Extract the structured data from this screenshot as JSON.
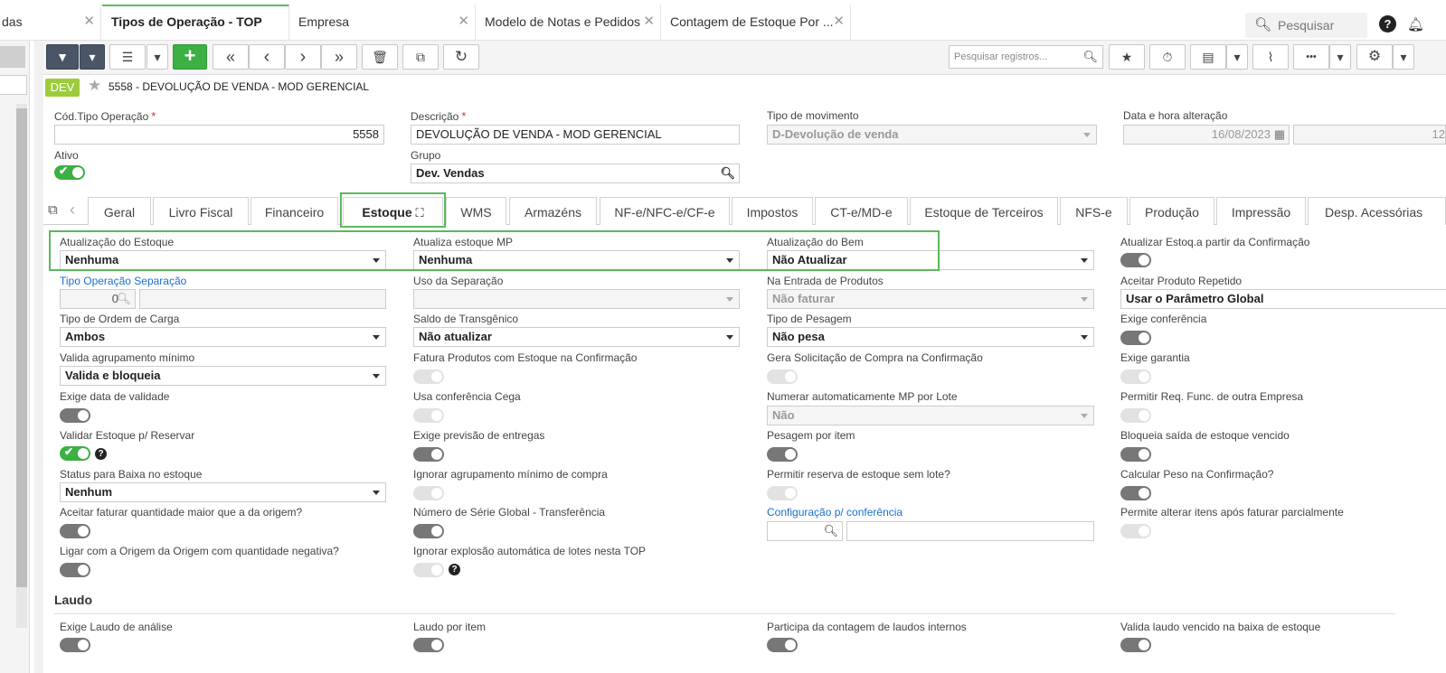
{
  "window_tabs": [
    {
      "label": "das",
      "active": false
    },
    {
      "label": "Tipos de Operação - TOP",
      "active": true
    },
    {
      "label": "Empresa",
      "active": false
    },
    {
      "label": "Modelo de Notas e Pedidos",
      "active": false
    },
    {
      "label": "Contagem de Estoque Por ...",
      "active": false
    }
  ],
  "close_glyph": "✕",
  "top_search": {
    "placeholder": "Pesquisar",
    "icon": "search-icon"
  },
  "help_glyph": "?",
  "toolbar": {
    "record_search_placeholder": "Pesquisar registros...",
    "icons": [
      "filter-icon",
      "dropdown-icon",
      "grid-icon",
      "dropdown-icon",
      "add-icon",
      "first-icon",
      "previous-icon",
      "next-icon",
      "last-icon",
      "delete-icon",
      "copy-icon",
      "refresh-icon",
      "star-icon",
      "timer-icon",
      "file-icon",
      "dropdown-icon",
      "attach-icon",
      "more-icon",
      "dropdown-icon",
      "gear-icon",
      "dropdown-icon"
    ],
    "add_glyph": "+",
    "first_glyph": "«",
    "previous_glyph": "‹",
    "next_glyph": "›",
    "last_glyph": "»",
    "filter_glyph": "▼",
    "dropdown_glyph": "▾",
    "grid_glyph": "☰",
    "delete_glyph": "🗑",
    "copy_glyph": "⧉",
    "refresh_glyph": "↻",
    "star_glyph": "★",
    "timer_glyph": "⏱",
    "file_glyph": "▤",
    "attach_glyph": "⌇",
    "more_glyph": "•••",
    "gear_glyph": "⚙"
  },
  "record": {
    "badge": "DEV",
    "title": "5558 - DEVOLUÇÃO DE VENDA - MOD GERENCIAL"
  },
  "header_fields": {
    "cod_label": "Cód.Tipo Operação",
    "cod_value": "5558",
    "desc_label": "Descrição",
    "desc_value": "DEVOLUÇÃO DE VENDA - MOD GERENCIAL",
    "tipo_mov_label": "Tipo de movimento",
    "tipo_mov_value": "D-Devolução de venda",
    "data_label": "Data e hora alteração",
    "data_value": "16/08/2023",
    "hora_value": "12",
    "ativo_label": "Ativo",
    "ativo_on": true,
    "grupo_label": "Grupo",
    "grupo_value": "Dev. Vendas",
    "required_mark": "*"
  },
  "tabs": [
    "Geral",
    "Livro Fiscal",
    "Financeiro",
    "Estoque",
    "WMS",
    "Armazéns",
    "NF-e/NFC-e/CF-e",
    "Impostos",
    "CT-e/MD-e",
    "Estoque de Terceiros",
    "NFS-e",
    "Produção",
    "Impressão",
    "Desp. Acessórias"
  ],
  "active_tab": "Estoque",
  "expand_glyph": "⛶",
  "tab_prev_glyph": "‹",
  "copy_icon_glyph": "⧉",
  "estoque": {
    "atualizacao_estoque": {
      "label": "Atualização do Estoque",
      "value": "Nenhuma"
    },
    "atualiza_mp": {
      "label": "Atualiza estoque MP",
      "value": "Nenhuma"
    },
    "atualizacao_bem": {
      "label": "Atualização do Bem",
      "value": "Não Atualizar"
    },
    "atualizar_confirmacao": {
      "label": "Atualizar Estoq.a partir da Confirmação"
    },
    "tipo_op_separacao": {
      "label": "Tipo Operação Separação",
      "value": "0"
    },
    "uso_separacao": {
      "label": "Uso da Separação",
      "value": ""
    },
    "na_entrada": {
      "label": "Na Entrada de Produtos",
      "value": "Não faturar"
    },
    "aceitar_repetido": {
      "label": "Aceitar Produto Repetido",
      "value": "Usar o Parâmetro Global"
    },
    "tipo_ordem_carga": {
      "label": "Tipo de Ordem de Carga",
      "value": "Ambos"
    },
    "saldo_transgenico": {
      "label": "Saldo de Transgênico",
      "value": "Não atualizar"
    },
    "tipo_pesagem": {
      "label": "Tipo de Pesagem",
      "value": "Não pesa"
    },
    "exige_conferencia": {
      "label": "Exige conferência"
    },
    "valida_agrupamento": {
      "label": "Valida agrupamento mínimo",
      "value": "Valida e bloqueia"
    },
    "fatura_produtos": {
      "label": "Fatura Produtos com Estoque na Confirmação"
    },
    "gera_solicitacao": {
      "label": "Gera Solicitação de Compra na Confirmação"
    },
    "exige_garantia": {
      "label": "Exige garantia"
    },
    "exige_validade": {
      "label": "Exige data de validade"
    },
    "usa_conferencia_cega": {
      "label": "Usa conferência Cega"
    },
    "numerar_mp": {
      "label": "Numerar automaticamente MP por Lote",
      "value": "Não"
    },
    "permitir_req": {
      "label": "Permitir Req. Func. de outra Empresa"
    },
    "validar_estoque": {
      "label": "Validar Estoque p/ Reservar",
      "on": true
    },
    "exige_previsao": {
      "label": "Exige previsão de entregas"
    },
    "pesagem_item": {
      "label": "Pesagem por item"
    },
    "bloqueia_saida": {
      "label": "Bloqueia saída de estoque vencido"
    },
    "status_baixa": {
      "label": "Status para Baixa no estoque",
      "value": "Nenhum"
    },
    "ignorar_agrupamento": {
      "label": "Ignorar agrupamento mínimo de compra"
    },
    "permitir_reserva": {
      "label": "Permitir reserva de estoque sem lote?"
    },
    "calcular_peso": {
      "label": "Calcular Peso na Confirmação?"
    },
    "aceitar_faturar": {
      "label": "Aceitar faturar quantidade maior que a da origem?"
    },
    "numero_serie": {
      "label": "Número de Série Global - Transferência"
    },
    "configuracao_conf": {
      "label": "Configuração p/ conferência",
      "value": ""
    },
    "permite_alterar": {
      "label": "Permite alterar itens após faturar parcialmente"
    },
    "ligar_origem": {
      "label": "Ligar com a Origem da Origem com quantidade negativa?"
    },
    "ignorar_explosao": {
      "label": "Ignorar explosão automática de lotes nesta TOP"
    }
  },
  "laudo": {
    "title": "Laudo",
    "exige_laudo": {
      "label": "Exige Laudo de análise"
    },
    "laudo_item": {
      "label": "Laudo por item"
    },
    "participa_contagem": {
      "label": "Participa da contagem de laudos internos"
    },
    "valida_laudo": {
      "label": "Valida laudo vencido na baixa de estoque"
    }
  },
  "colors": {
    "accent": "#3cb043",
    "highlight": "#5cb85c",
    "link": "#1a6fd1",
    "toolbar_dark": "#4a5566",
    "badge": "#9ccc3c"
  }
}
